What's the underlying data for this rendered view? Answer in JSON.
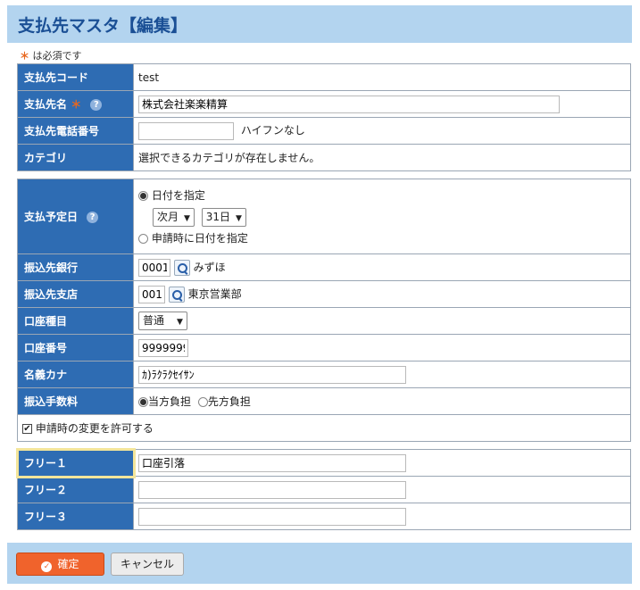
{
  "header": {
    "title": "支払先マスタ【編集】"
  },
  "required_note": {
    "star": "＊",
    "text": "は必須です"
  },
  "basic": {
    "code_label": "支払先コード",
    "code_value": "test",
    "name_label": "支払先名",
    "name_required": "＊",
    "name_value": "株式会社楽楽精算",
    "phone_label": "支払先電話番号",
    "phone_value": "",
    "phone_note": "ハイフンなし",
    "category_label": "カテゴリ",
    "category_text": "選択できるカテゴリが存在しません。"
  },
  "payment": {
    "date_label": "支払予定日",
    "option_date": "日付を指定",
    "month_select": "次月",
    "day_select": "31日",
    "option_apply": "申請時に日付を指定",
    "bank_label": "振込先銀行",
    "bank_code": "0001",
    "bank_name": "みずほ",
    "branch_label": "振込先支店",
    "branch_code": "001",
    "branch_name": "東京営業部",
    "account_type_label": "口座種目",
    "account_type_value": "普通",
    "account_number_label": "口座番号",
    "account_number_value": "9999999",
    "kana_label": "名義カナ",
    "kana_value": "ｶ)ﾗｸﾗｸｾｲｻﾝ",
    "fee_label": "振込手数料",
    "fee_option_self": "当方負担",
    "fee_option_other": "先方負担",
    "allow_change_label": "申請時の変更を許可する"
  },
  "free": {
    "free1_label": "フリー１",
    "free1_value": "口座引落",
    "free2_label": "フリー２",
    "free2_value": "",
    "free3_label": "フリー３",
    "free3_value": ""
  },
  "buttons": {
    "ok": "確定",
    "cancel": "キャンセル"
  },
  "help_glyph": "?",
  "colors": {
    "header_cell": "#2e6cb3",
    "frame": "#b3d4ef",
    "ok_button": "#f0632c",
    "required": "#e8671e"
  }
}
